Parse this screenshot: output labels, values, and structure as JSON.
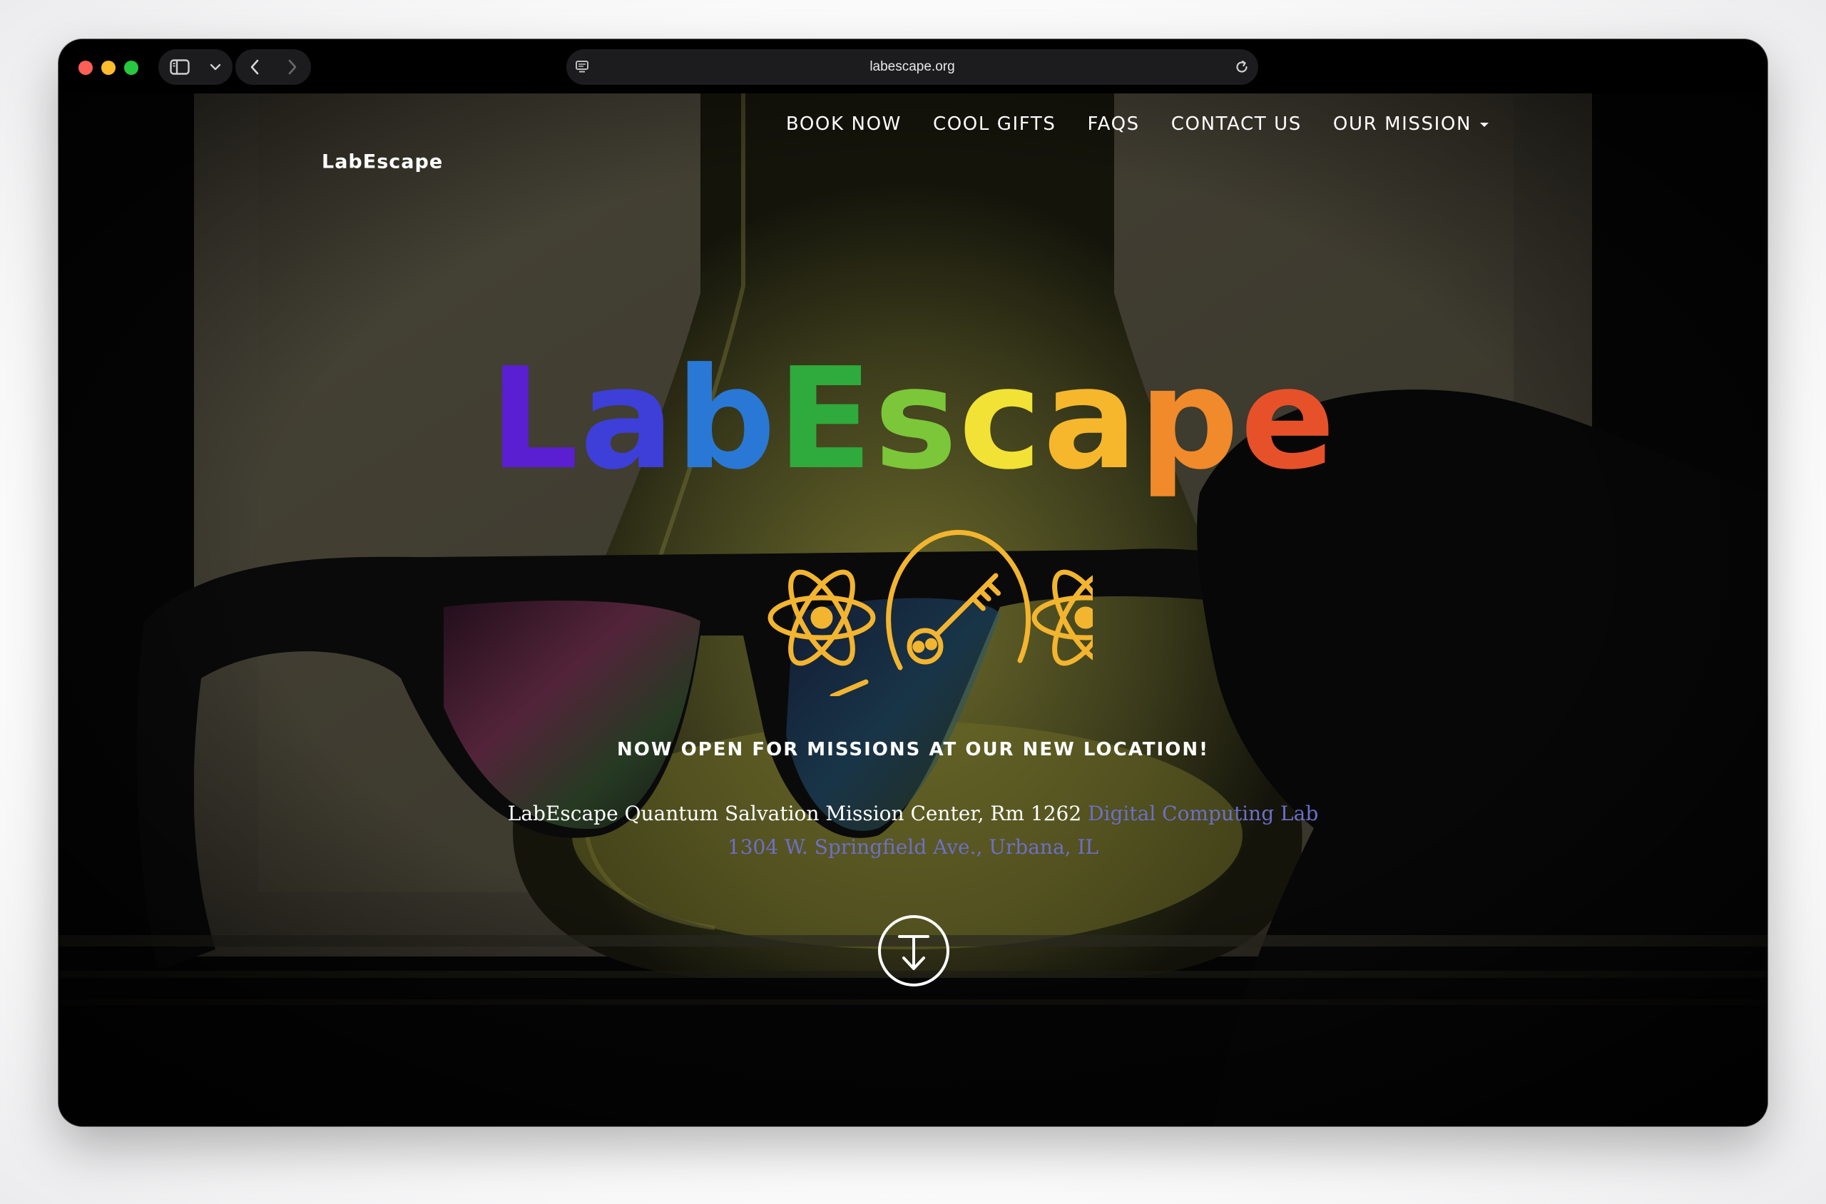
{
  "browser": {
    "url": "labescape.org"
  },
  "site": {
    "brand": "LabEscape",
    "nav": [
      {
        "label": "BOOK NOW"
      },
      {
        "label": "COOL GIFTS"
      },
      {
        "label": "FAQS"
      },
      {
        "label": "CONTACT US"
      },
      {
        "label": "OUR MISSION",
        "has_dropdown": true
      }
    ],
    "hero": {
      "logo_text": "LabEscape",
      "logo_colors": [
        "#5a1fd1",
        "#3d3fd8",
        "#2a78d6",
        "#2faa3c",
        "#7cc63a",
        "#f2e235",
        "#f6b72d",
        "#f08a2a",
        "#e7512a"
      ],
      "emblem_color": "#f3b52f",
      "tagline": "NOW OPEN FOR MISSIONS AT OUR NEW LOCATION!",
      "address_prefix": "LabEscape Quantum Salvation Mission Center, Rm 1262 ",
      "address_link1": "Digital Computing Lab",
      "address_link2": "1304 W. Springfield Ave., Urbana, IL",
      "link_color": "#6d6fc7"
    }
  }
}
